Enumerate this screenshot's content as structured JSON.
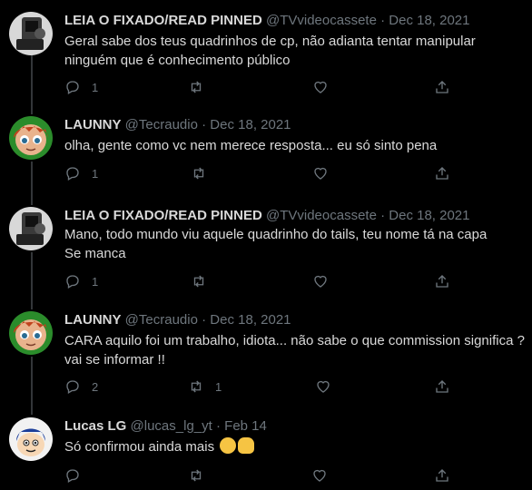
{
  "tweets": [
    {
      "name": "LEIA O FIXADO/READ PINNED",
      "handle": "@TVvideocassete",
      "sep": "·",
      "date": "Dec 18, 2021",
      "lines": [
        "Geral sabe dos teus quadrinhos de cp, não adianta tentar manipular",
        "ninguém que é conhecimento público"
      ],
      "reply_count": "1",
      "retweet_count": "",
      "avatar": "camera-avatar"
    },
    {
      "name": "LAUNNY",
      "handle": "@Tecraudio",
      "sep": "·",
      "date": "Dec 18, 2021",
      "lines": [
        "olha, gente como vc nem merece resposta... eu só sinto pena"
      ],
      "reply_count": "1",
      "retweet_count": "",
      "avatar": "redhair-avatar"
    },
    {
      "name": "LEIA O FIXADO/READ PINNED",
      "handle": "@TVvideocassete",
      "sep": "·",
      "date": "Dec 18, 2021",
      "lines": [
        "Mano, todo mundo viu aquele quadrinho do tails, teu nome tá na capa",
        "Se manca"
      ],
      "reply_count": "1",
      "retweet_count": "",
      "avatar": "camera-avatar"
    },
    {
      "name": "LAUNNY",
      "handle": "@Tecraudio",
      "sep": "·",
      "date": "Dec 18, 2021",
      "lines": [
        "CARA aquilo foi um trabalho, idiota... não sabe o que commission significa ?",
        "vai se informar !!"
      ],
      "reply_count": "2",
      "retweet_count": "1",
      "avatar": "redhair-avatar"
    },
    {
      "name": "Lucas LG",
      "handle": "@lucas_lg_yt",
      "sep": "·",
      "date": "Feb 14",
      "lines": [
        "Só confirmou ainda mais"
      ],
      "reply_count": "",
      "retweet_count": "",
      "avatar": "cartoon-avatar",
      "emojis": [
        "relieved-face",
        "raised-fist"
      ]
    }
  ],
  "colors": {
    "background": "#000000",
    "text": "#d9d9d9",
    "muted": "#6e767d",
    "thread_line": "#333639"
  }
}
